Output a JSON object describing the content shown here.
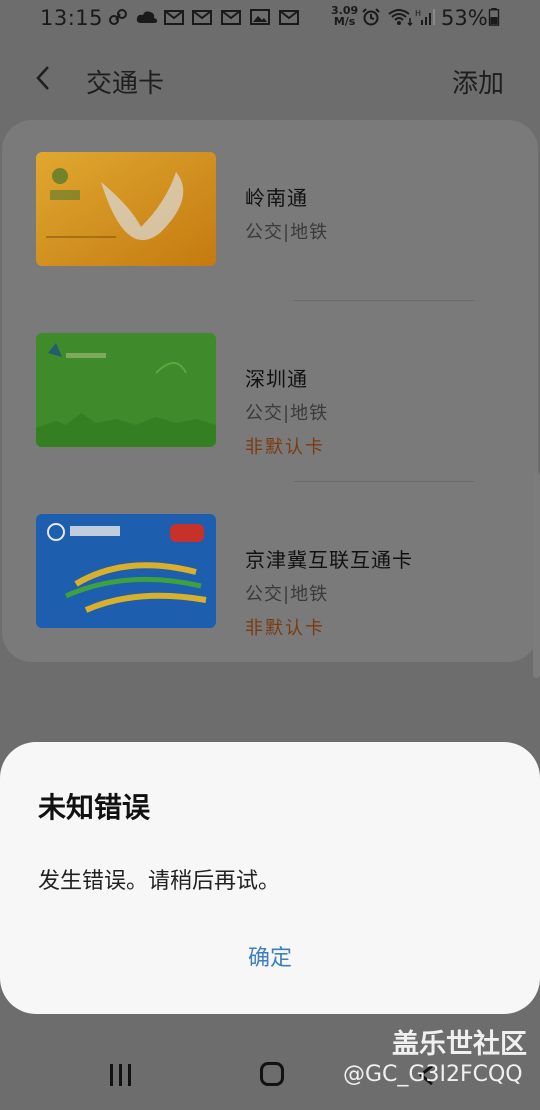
{
  "status_bar": {
    "time": "13:15",
    "speed_value": "3.09",
    "speed_unit": "M/s",
    "battery": "53%",
    "icons": [
      "link-icon",
      "cloud-icon",
      "mail-icon",
      "mail-icon",
      "mail-icon",
      "image-icon",
      "mail-icon",
      "alarm-icon",
      "wifi-icon",
      "signal-icon",
      "battery-icon"
    ]
  },
  "header": {
    "title": "交通卡",
    "add_label": "添加"
  },
  "cards": [
    {
      "name": "岭南通",
      "type": "公交|地铁",
      "flag": "",
      "color": "#e8a21a"
    },
    {
      "name": "深圳通",
      "type": "公交|地铁",
      "flag": "非默认卡",
      "color": "#3e8f2d"
    },
    {
      "name": "京津冀互联互通卡",
      "type": "公交|地铁",
      "flag": "非默认卡",
      "color": "#1f62b5"
    }
  ],
  "dialog": {
    "title": "未知错误",
    "message": "发生错误。请稍后再试。",
    "button": "确定"
  },
  "watermark": {
    "line1": "盖乐世社区",
    "line2": "@GC_G3I2FCQQ"
  }
}
